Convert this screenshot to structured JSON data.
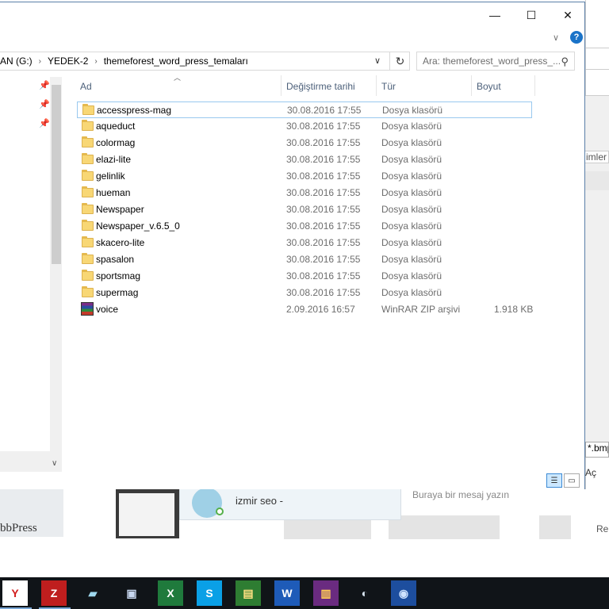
{
  "window": {
    "minimize_glyph": "—",
    "maximize_glyph": "☐",
    "close_glyph": "✕",
    "help_glyph": "?",
    "ribbon_expand_glyph": "∨"
  },
  "address": {
    "crumbs": [
      "AN (G:)",
      "YEDEK-2",
      "themeforest_word_press_temaları"
    ],
    "separator_glyph": "›",
    "dropdown_glyph": "∨",
    "refresh_glyph": "↻"
  },
  "search": {
    "placeholder": "Ara: themeforest_word_press_...",
    "icon": "search-icon"
  },
  "columns": {
    "name": "Ad",
    "date": "Değiştirme tarihi",
    "type": "Tür",
    "size": "Boyut"
  },
  "files": [
    {
      "name": "accesspress-mag",
      "date": "30.08.2016 17:55",
      "type": "Dosya klasörü",
      "size": "",
      "icon": "folder-icon"
    },
    {
      "name": "aqueduct",
      "date": "30.08.2016 17:55",
      "type": "Dosya klasörü",
      "size": "",
      "icon": "folder-icon"
    },
    {
      "name": "colormag",
      "date": "30.08.2016 17:55",
      "type": "Dosya klasörü",
      "size": "",
      "icon": "folder-icon"
    },
    {
      "name": "elazi-lite",
      "date": "30.08.2016 17:55",
      "type": "Dosya klasörü",
      "size": "",
      "icon": "folder-icon"
    },
    {
      "name": "gelinlik",
      "date": "30.08.2016 17:55",
      "type": "Dosya klasörü",
      "size": "",
      "icon": "folder-icon"
    },
    {
      "name": "hueman",
      "date": "30.08.2016 17:55",
      "type": "Dosya klasörü",
      "size": "",
      "icon": "folder-icon"
    },
    {
      "name": "Newspaper",
      "date": "30.08.2016 17:55",
      "type": "Dosya klasörü",
      "size": "",
      "icon": "folder-icon"
    },
    {
      "name": "Newspaper_v.6.5_0",
      "date": "30.08.2016 17:55",
      "type": "Dosya klasörü",
      "size": "",
      "icon": "folder-icon"
    },
    {
      "name": "skacero-lite",
      "date": "30.08.2016 17:55",
      "type": "Dosya klasörü",
      "size": "",
      "icon": "folder-icon"
    },
    {
      "name": "spasalon",
      "date": "30.08.2016 17:55",
      "type": "Dosya klasörü",
      "size": "",
      "icon": "folder-icon"
    },
    {
      "name": "sportsmag",
      "date": "30.08.2016 17:55",
      "type": "Dosya klasörü",
      "size": "",
      "icon": "folder-icon"
    },
    {
      "name": "supermag",
      "date": "30.08.2016 17:55",
      "type": "Dosya klasörü",
      "size": "",
      "icon": "folder-icon"
    },
    {
      "name": "voice",
      "date": "2.09.2016 16:57",
      "type": "WinRAR ZIP arşivi",
      "size": "1.918 KB",
      "icon": "winrar-icon"
    }
  ],
  "selected_index": 0,
  "background": {
    "imler_text": "imler",
    "bmp_text": "*.bmp",
    "ac_text": "Aç",
    "bbpress_text": "bbPress",
    "chat_name": "izmir seo -",
    "chat_placeholder": "Buraya bir mesaj yazın",
    "re_text": "Re"
  },
  "taskbar": {
    "items": [
      {
        "name": "yandex-browser-icon",
        "glyph": "Y",
        "bg": "#ffffff",
        "fg": "#d21e1e"
      },
      {
        "name": "filezilla-icon",
        "glyph": "Z",
        "bg": "#bf1e1e",
        "fg": "#ffffff"
      },
      {
        "name": "notepad-icon",
        "glyph": "▰",
        "bg": "#101418",
        "fg": "#9fd8ee"
      },
      {
        "name": "network-computer-icon",
        "glyph": "▣",
        "bg": "#101418",
        "fg": "#c8d8f0"
      },
      {
        "name": "excel-icon",
        "glyph": "X",
        "bg": "#1f7a3c",
        "fg": "#ffffff"
      },
      {
        "name": "skype-icon",
        "glyph": "S",
        "bg": "#0aa0e6",
        "fg": "#ffffff"
      },
      {
        "name": "project-icon",
        "glyph": "▤",
        "bg": "#2e7d32",
        "fg": "#ffe082"
      },
      {
        "name": "word-icon",
        "glyph": "W",
        "bg": "#1e5bb8",
        "fg": "#ffffff"
      },
      {
        "name": "winrar-taskbar-icon",
        "glyph": "▥",
        "bg": "#6a2b80",
        "fg": "#ffcc55"
      },
      {
        "name": "disc-tool-icon",
        "glyph": "◐",
        "bg": "#101418",
        "fg": "#d8e4f0"
      },
      {
        "name": "cd-burner-icon",
        "glyph": "◉",
        "bg": "#1d4e9e",
        "fg": "#cfe3ff"
      }
    ]
  }
}
